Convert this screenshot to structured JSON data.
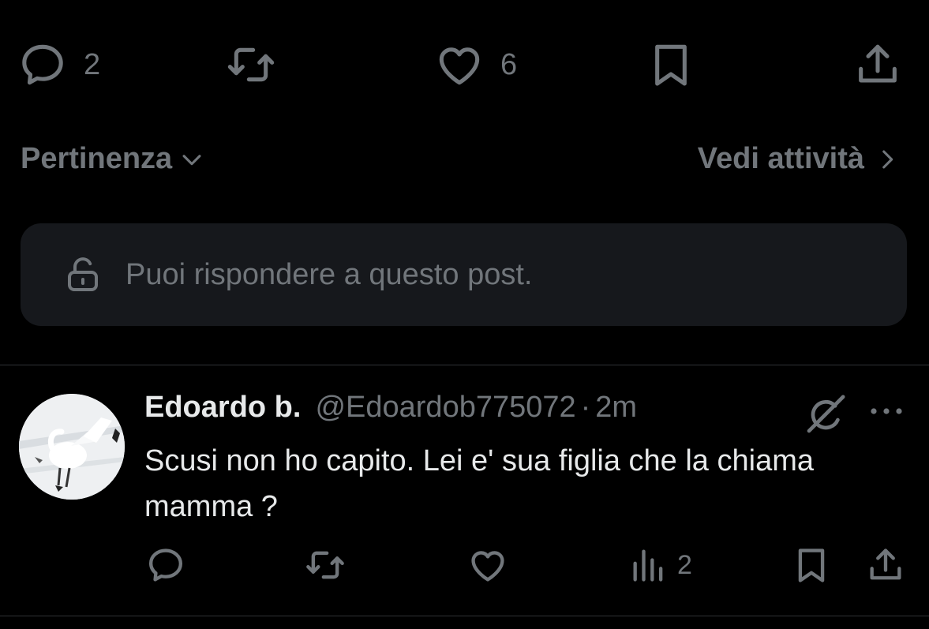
{
  "tweet_actions": {
    "reply_count": "2",
    "like_count": "6"
  },
  "sort": {
    "label": "Pertinenza",
    "activity_label": "Vedi attività"
  },
  "reply_permission": {
    "text": "Puoi rispondere a questo post."
  },
  "post": {
    "display_name": "Edoardo b.",
    "handle": "@Edoardob775072",
    "separator": "·",
    "time": "2m",
    "text": "Scusi non ho capito. Lei e' sua figlia che la chiama mamma ?",
    "views_count": "2"
  },
  "colors": {
    "background": "#000000",
    "muted": "#71767b",
    "text": "#e7e9ea",
    "box": "#16181c",
    "divider": "#2f3336"
  }
}
